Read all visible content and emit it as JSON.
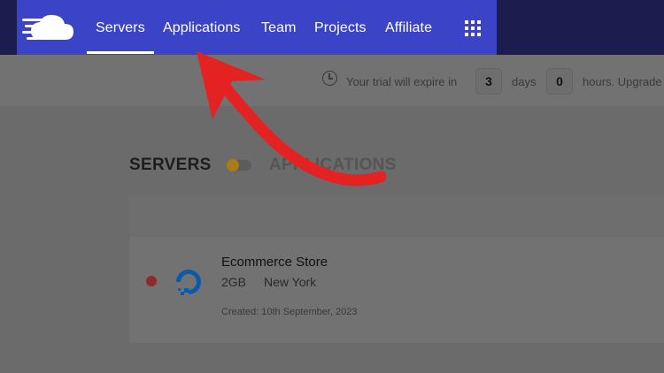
{
  "nav": {
    "items": [
      {
        "label": "Servers",
        "active": true
      },
      {
        "label": "Applications",
        "active": false
      },
      {
        "label": "Team",
        "active": false
      },
      {
        "label": "Projects",
        "active": false
      },
      {
        "label": "Affiliate",
        "active": false
      }
    ],
    "grid_icon": "apps-grid-icon",
    "logo_icon": "cloud-logo-icon"
  },
  "trial": {
    "prefix": "Your trial will expire in",
    "days_value": "3",
    "days_label": "days",
    "hours_value": "0",
    "hours_label": "hours. Upgrade"
  },
  "section": {
    "servers_label": "SERVERS",
    "applications_label": "APPLICATIONS"
  },
  "server": {
    "name": "Ecommerce Store",
    "size": "2GB",
    "location": "New York",
    "created": "Created: 10th September, 2023",
    "status_color": "#e53935"
  },
  "colors": {
    "nav_highlight": "#3b43c7",
    "arrow": "#e52222"
  }
}
